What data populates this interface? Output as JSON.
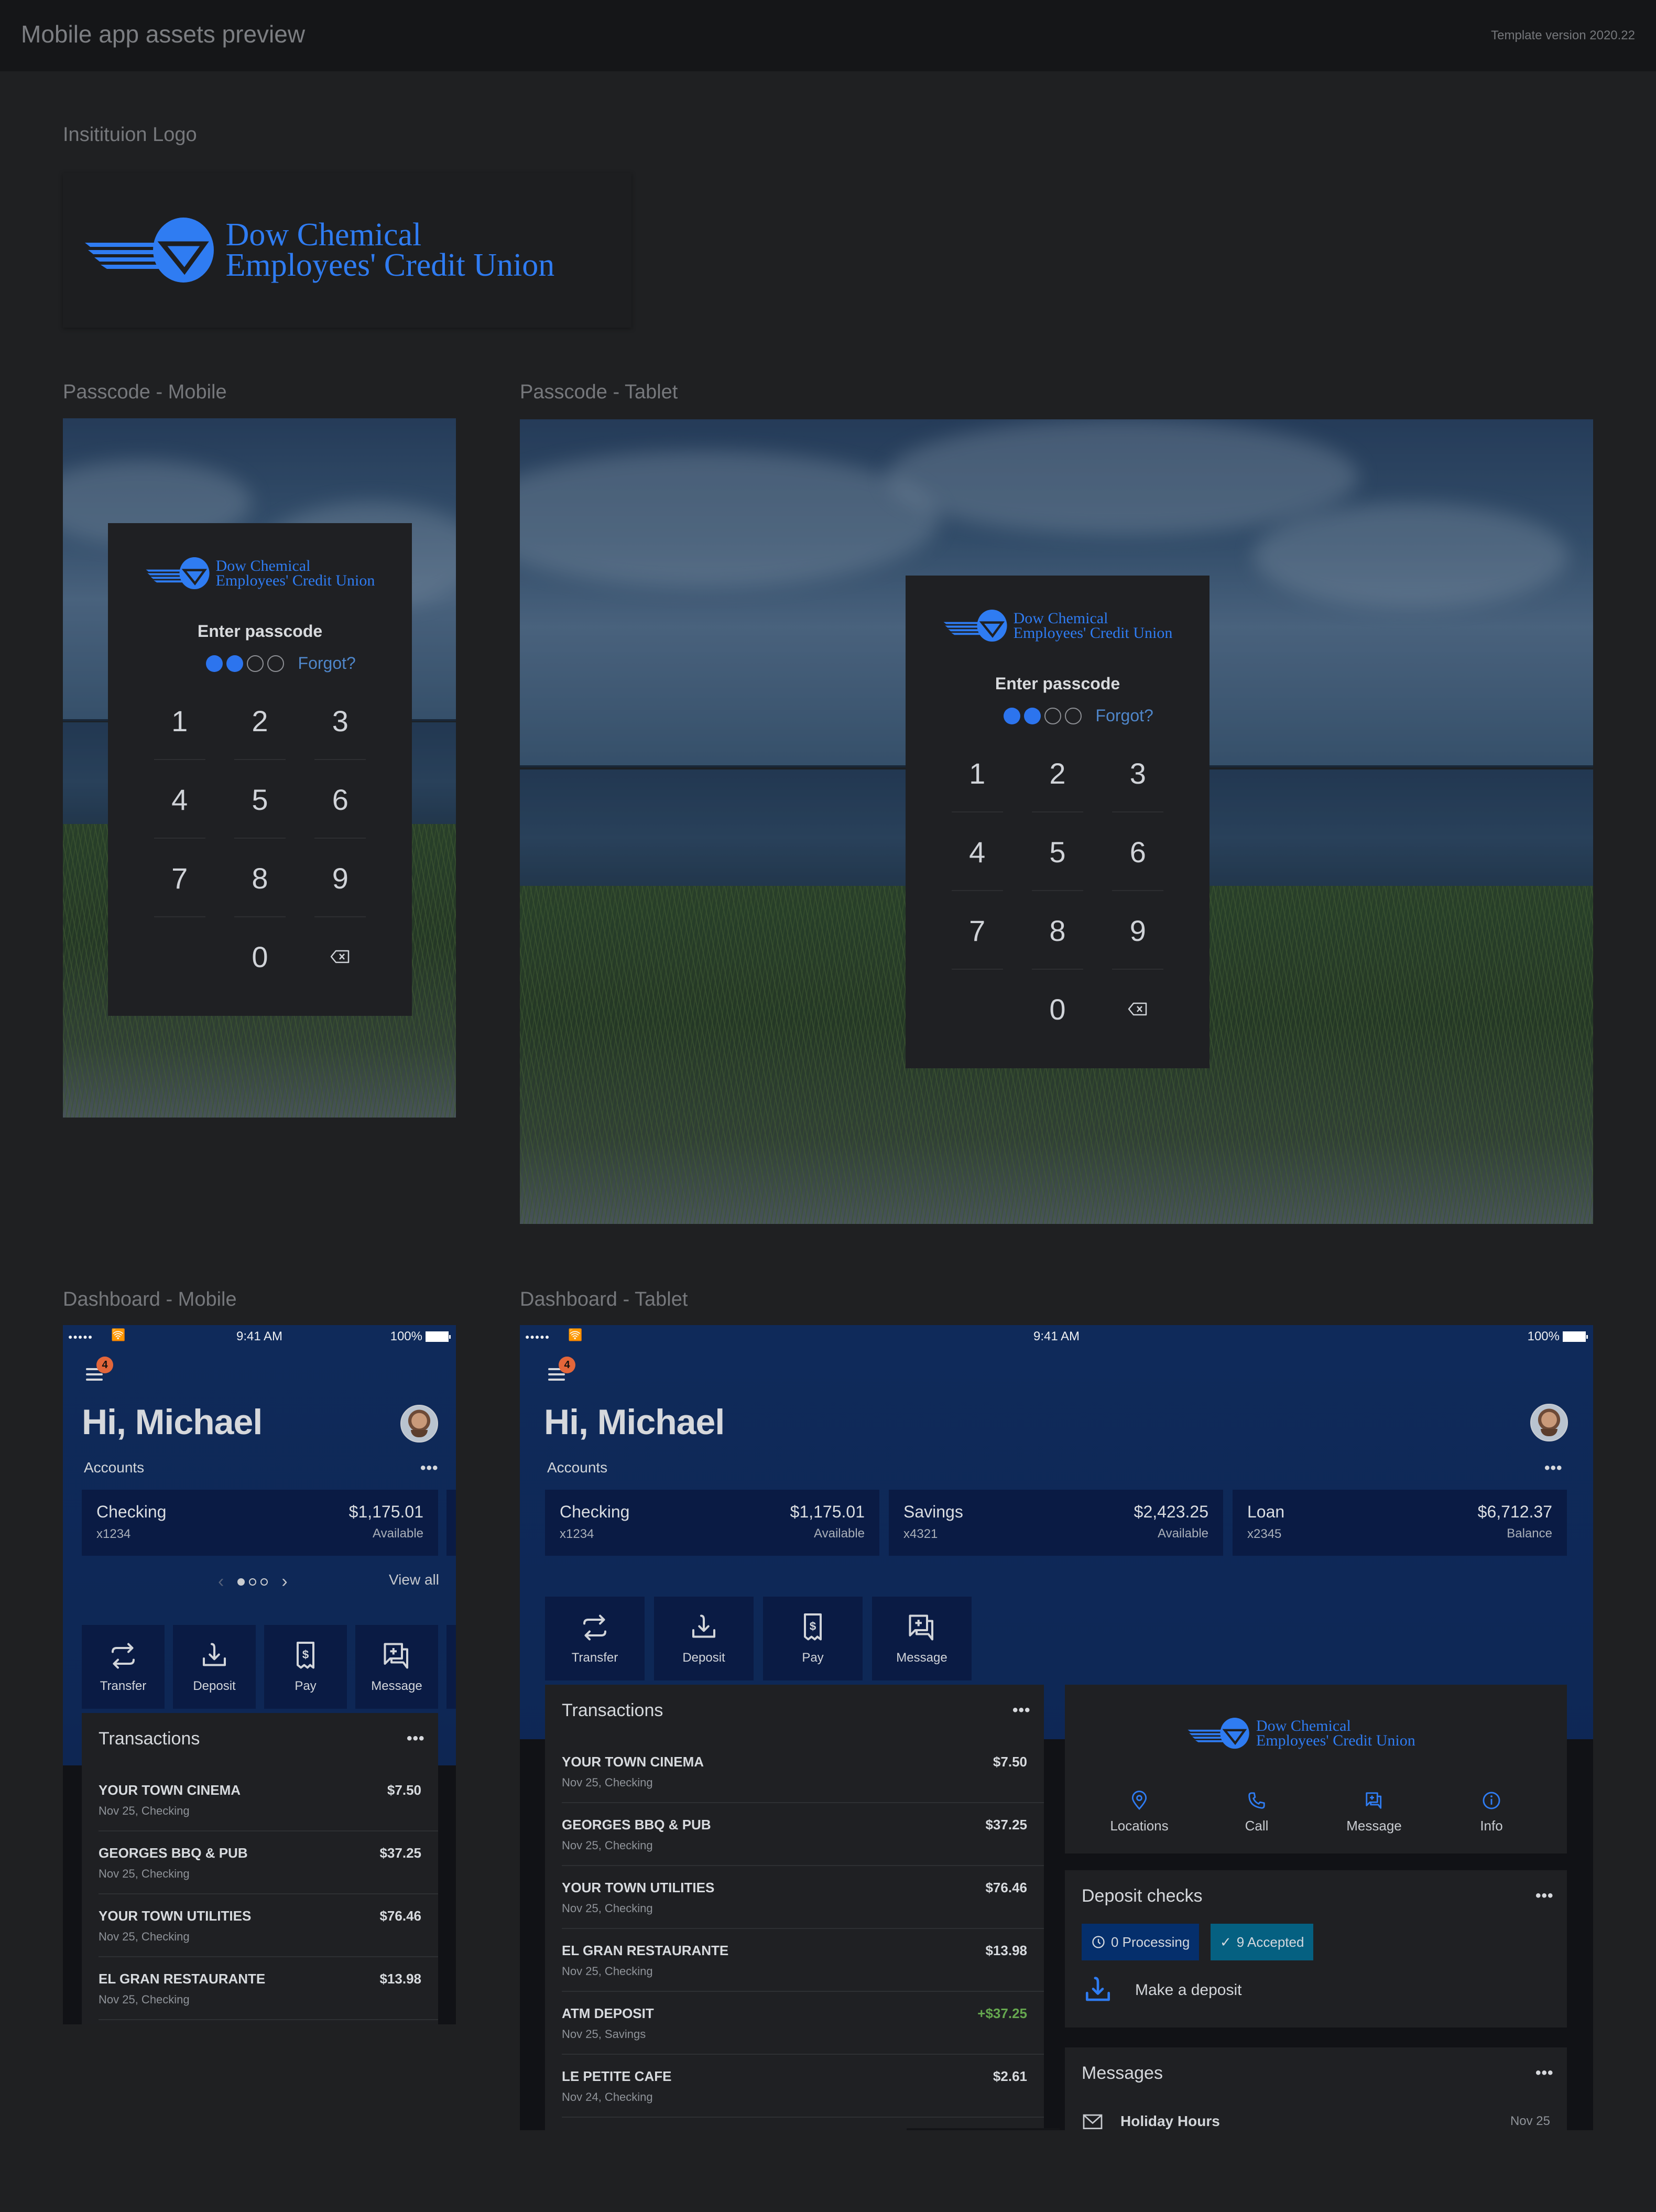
{
  "header": {
    "title": "Mobile app assets preview",
    "version": "Template version 2020.22"
  },
  "sections": {
    "logo": "Insitituion Logo",
    "passcode_mobile": "Passcode - Mobile",
    "passcode_tablet": "Passcode - Tablet",
    "dashboard_mobile": "Dashboard - Mobile",
    "dashboard_tablet": "Dashboard - Tablet"
  },
  "brand": {
    "line1": "Dow Chemical",
    "line2": "Employees' Credit Union",
    "color": "#2f7cf2"
  },
  "passcode": {
    "prompt": "Enter passcode",
    "forgot": "Forgot?",
    "digits_entered": 2,
    "digits_total": 4,
    "keys": [
      "1",
      "2",
      "3",
      "4",
      "5",
      "6",
      "7",
      "8",
      "9",
      "",
      "0",
      "backspace"
    ],
    "accent": "#2c74ee"
  },
  "status_bar": {
    "time": "9:41 AM",
    "battery": "100%",
    "signal": "●●●●●"
  },
  "dashboard": {
    "greeting": "Hi, Michael",
    "notification_count": "4",
    "accounts_label": "Accounts",
    "more": "•••",
    "view_all": "View all",
    "pager": {
      "current": 1,
      "total": 3
    },
    "accounts": [
      {
        "name": "Checking",
        "number": "x1234",
        "amount": "$1,175.01",
        "label": "Available"
      },
      {
        "name": "Savings",
        "number": "x4321",
        "amount": "$2,423.25",
        "label": "Available"
      },
      {
        "name": "Loan",
        "number": "x2345",
        "amount": "$6,712.37",
        "label": "Balance"
      }
    ],
    "quick_actions": [
      {
        "label": "Transfer",
        "icon": "transfer-icon"
      },
      {
        "label": "Deposit",
        "icon": "deposit-icon"
      },
      {
        "label": "Pay",
        "icon": "pay-bill-icon"
      },
      {
        "label": "Message",
        "icon": "message-icon"
      }
    ],
    "transactions_title": "Transactions",
    "transactions": [
      {
        "name": "YOUR TOWN CINEMA",
        "sub": "Nov 25, Checking",
        "amount": "$7.50",
        "credit": false
      },
      {
        "name": "GEORGES BBQ & PUB",
        "sub": "Nov 25, Checking",
        "amount": "$37.25",
        "credit": false
      },
      {
        "name": "YOUR TOWN UTILITIES",
        "sub": "Nov 25, Checking",
        "amount": "$76.46",
        "credit": false
      },
      {
        "name": "EL GRAN RESTAURANTE",
        "sub": "Nov 25, Checking",
        "amount": "$13.98",
        "credit": false
      },
      {
        "name": "ATM DEPOSIT",
        "sub": "Nov 25, Savings",
        "amount": "+$37.25",
        "credit": true
      },
      {
        "name": "LE PETITE CAFE",
        "sub": "Nov 24, Checking",
        "amount": "$2.61",
        "credit": false
      }
    ],
    "contact_actions": [
      {
        "label": "Locations",
        "icon": "location-pin-icon"
      },
      {
        "label": "Call",
        "icon": "phone-icon"
      },
      {
        "label": "Message",
        "icon": "message-icon"
      },
      {
        "label": "Info",
        "icon": "info-icon"
      }
    ],
    "deposit": {
      "title": "Deposit checks",
      "processing": "0 Processing",
      "accepted": "9 Accepted",
      "make_deposit": "Make a deposit"
    },
    "messages": {
      "title": "Messages",
      "items": [
        {
          "subject": "Holiday Hours",
          "date": "Nov 25"
        }
      ]
    },
    "colors": {
      "credit": "#66a84f",
      "badge": "#e3663a",
      "processing": "#052f6c",
      "accepted": "#056081"
    }
  }
}
